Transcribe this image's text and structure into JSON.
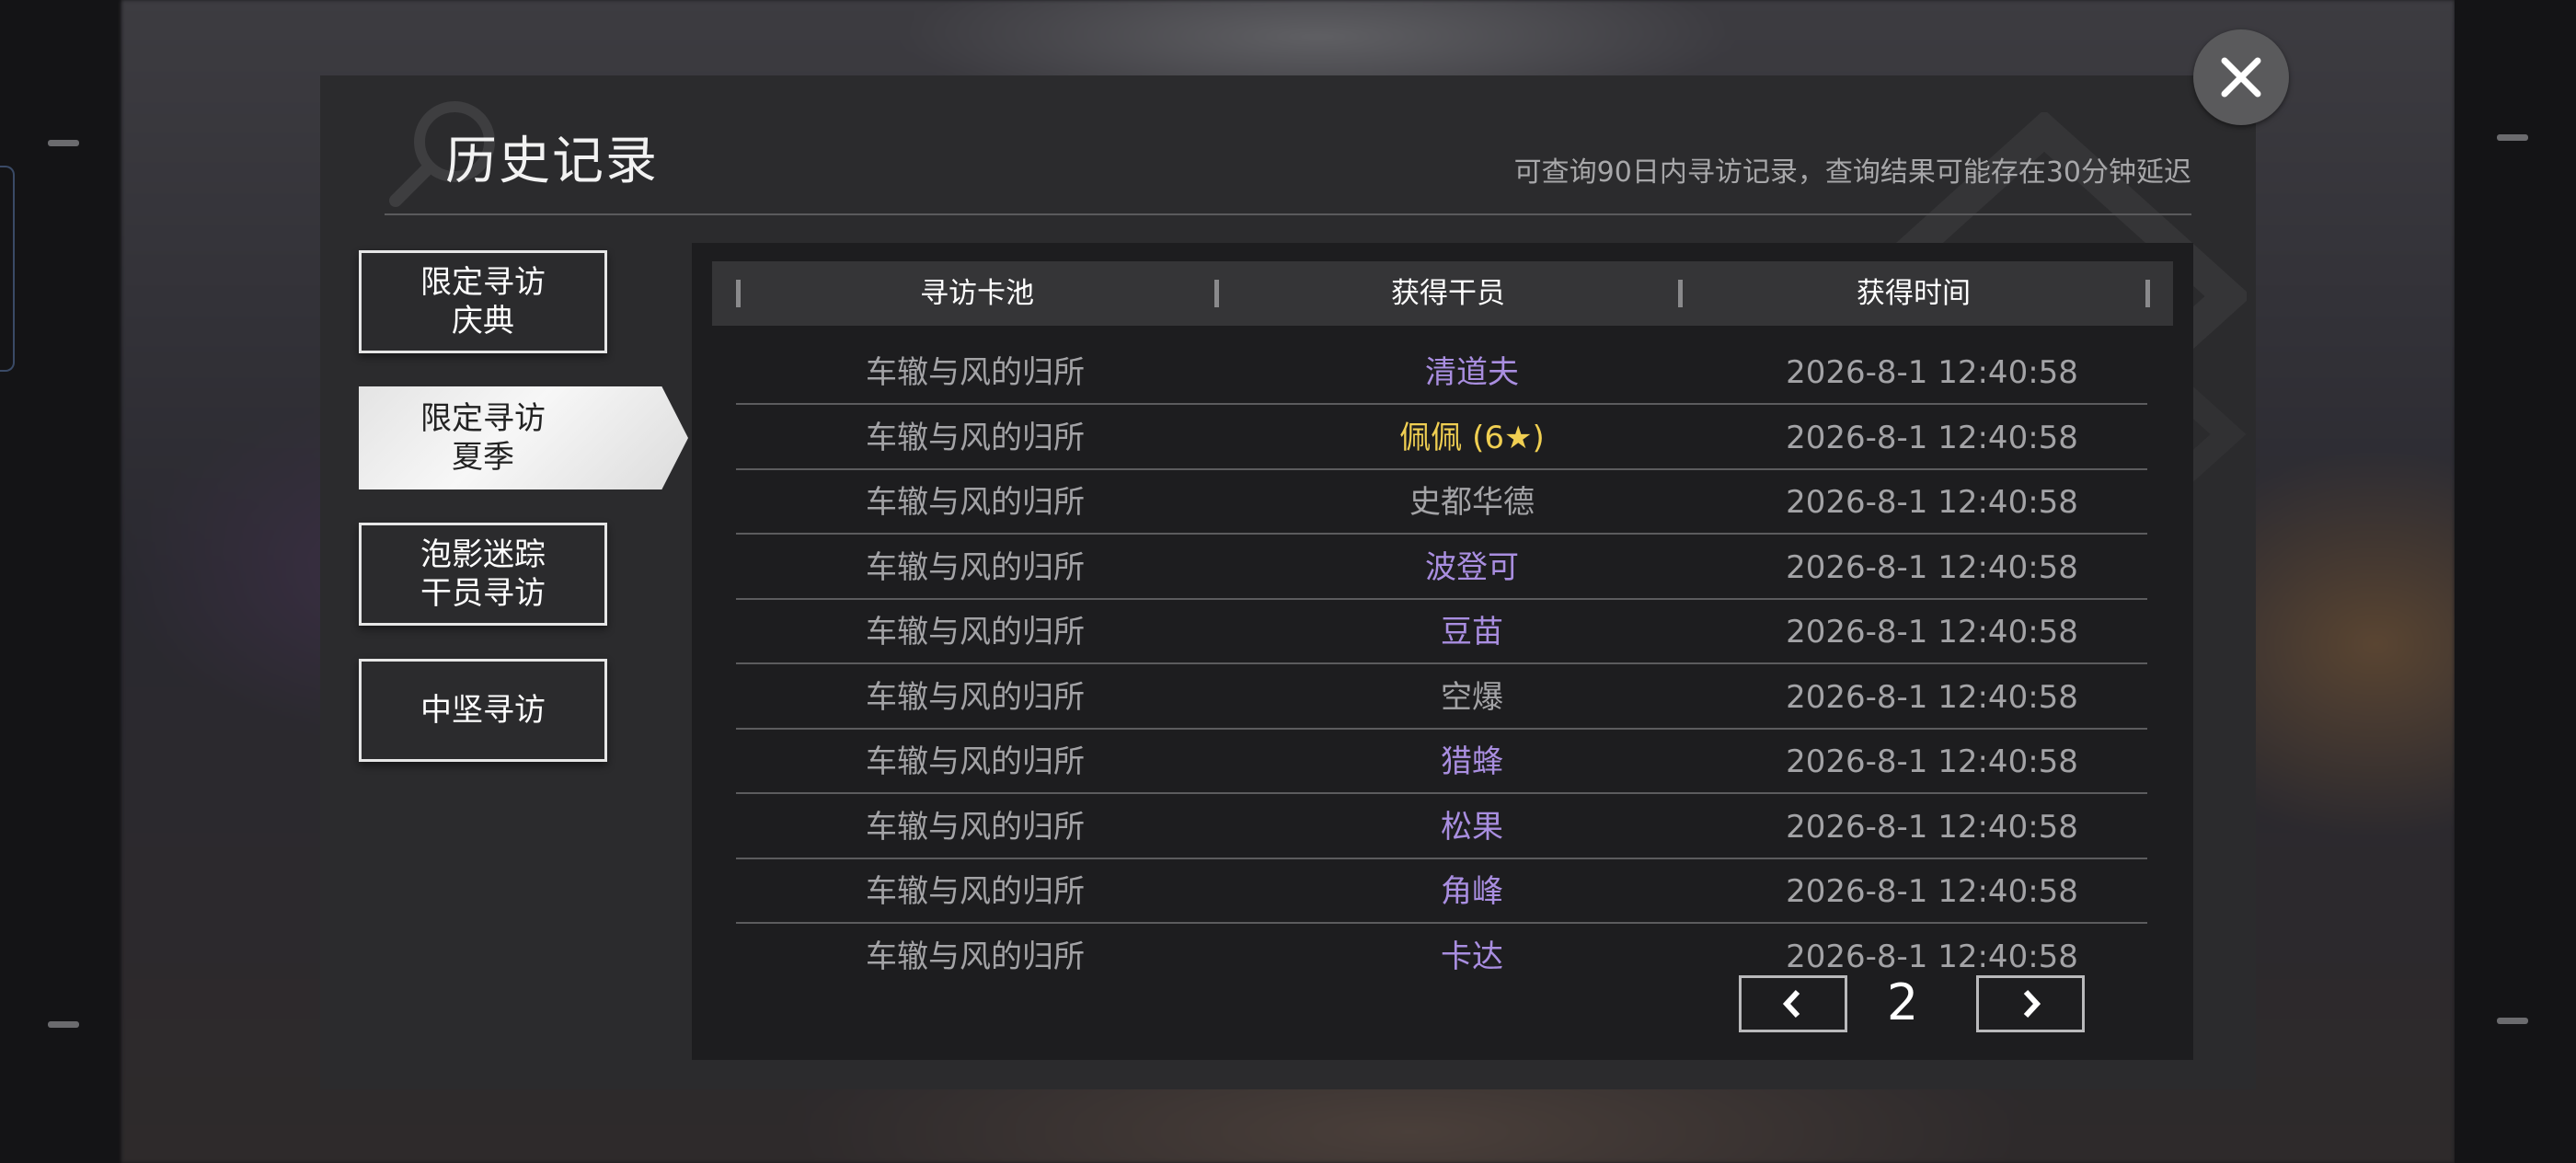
{
  "dialog": {
    "title": "历史记录",
    "subtitle": "可查询90日内寻访记录，查询结果可能存在30分钟延迟"
  },
  "tabs": [
    {
      "line1": "限定寻访",
      "line2": "庆典",
      "selected": false
    },
    {
      "line1": "限定寻访",
      "line2": "夏季",
      "selected": true
    },
    {
      "line1": "泡影迷踪",
      "line2": "干员寻访",
      "selected": false
    },
    {
      "line1": "中坚寻访",
      "line2": "",
      "selected": false
    }
  ],
  "table": {
    "headers": [
      "寻访卡池",
      "获得干员",
      "获得时间"
    ],
    "rows": [
      {
        "pool": "车辙与风的归所",
        "operator": "清道夫",
        "time": "2026-8-1 12:40:58",
        "rarity_color": "#a98ee0"
      },
      {
        "pool": "车辙与风的归所",
        "operator": "佩佩 (6★)",
        "time": "2026-8-1 12:40:58",
        "rarity_color": "#f0cf52"
      },
      {
        "pool": "车辙与风的归所",
        "operator": "史都华德",
        "time": "2026-8-1 12:40:58",
        "rarity_color": "#a3a3a6"
      },
      {
        "pool": "车辙与风的归所",
        "operator": "波登可",
        "time": "2026-8-1 12:40:58",
        "rarity_color": "#a98ee0"
      },
      {
        "pool": "车辙与风的归所",
        "operator": "豆苗",
        "time": "2026-8-1 12:40:58",
        "rarity_color": "#a98ee0"
      },
      {
        "pool": "车辙与风的归所",
        "operator": "空爆",
        "time": "2026-8-1 12:40:58",
        "rarity_color": "#a3a3a6"
      },
      {
        "pool": "车辙与风的归所",
        "operator": "猎蜂",
        "time": "2026-8-1 12:40:58",
        "rarity_color": "#a98ee0"
      },
      {
        "pool": "车辙与风的归所",
        "operator": "松果",
        "time": "2026-8-1 12:40:58",
        "rarity_color": "#a98ee0"
      },
      {
        "pool": "车辙与风的归所",
        "operator": "角峰",
        "time": "2026-8-1 12:40:58",
        "rarity_color": "#a98ee0"
      },
      {
        "pool": "车辙与风的归所",
        "operator": "卡达",
        "time": "2026-8-1 12:40:58",
        "rarity_color": "#a98ee0"
      }
    ]
  },
  "pager": {
    "current_page": "2",
    "prev_icon": "chevron-left-icon",
    "next_icon": "chevron-right-icon"
  },
  "close_icon": "close-icon",
  "colors": {
    "accent_purple": "#a98ee0",
    "accent_gold": "#f0cf52",
    "text_muted": "#a3a3a6"
  }
}
